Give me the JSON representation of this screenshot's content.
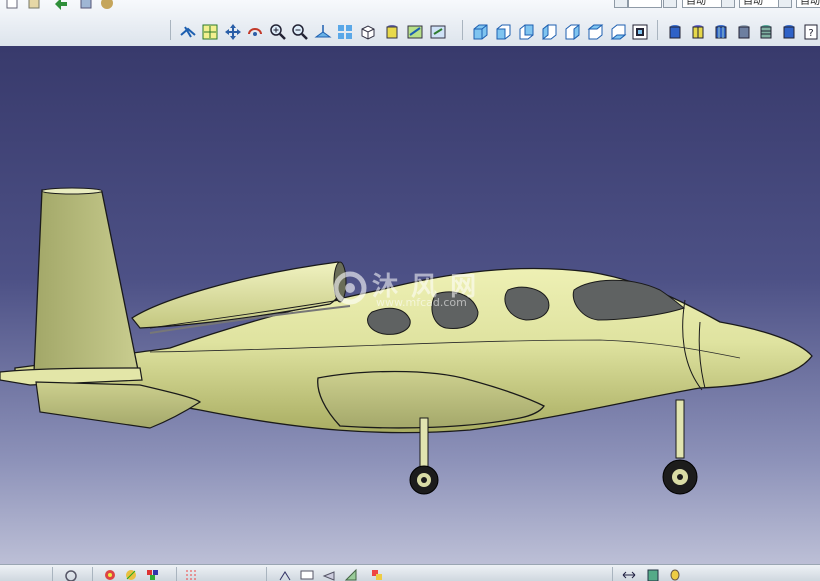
{
  "toolbar": {
    "dropdowns": [
      {
        "value": ""
      },
      {
        "value": "自动"
      },
      {
        "value": "自动"
      },
      {
        "value": "自动"
      }
    ],
    "view_tools": [
      "fly-icon",
      "fit-all-icon",
      "pan-icon",
      "rotate-icon",
      "zoom-in-icon",
      "zoom-out-icon",
      "normal-view-icon",
      "multi-view-icon",
      "iso-view-icon",
      "shading-icon",
      "hide-show-icon",
      "swap-space-icon"
    ],
    "standard_views": [
      "isometric-view-icon",
      "front-view-icon",
      "back-view-icon",
      "left-view-icon",
      "right-view-icon",
      "top-view-icon",
      "bottom-view-icon",
      "named-views-icon"
    ],
    "render_styles": [
      "shading-render-icon",
      "shading-edges-icon",
      "shading-no-edges-icon",
      "wireframe-icon",
      "customize-view-icon",
      "help-icon"
    ]
  },
  "watermark": {
    "brand": "沐 风 网",
    "url": "www.mfcad.com"
  },
  "colors": {
    "body": "#dfe3a0",
    "body_shadow": "#b9bd6f",
    "wing": "#c4c88c",
    "outline": "#1a1a1a",
    "window": "#5f6262",
    "accent": "#2f7fd1"
  }
}
